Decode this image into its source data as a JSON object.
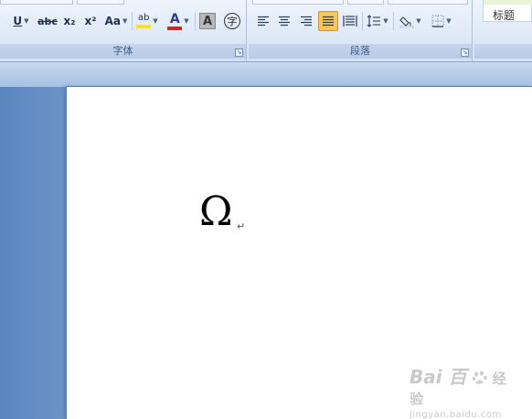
{
  "ribbon": {
    "font_group": {
      "label": "字体",
      "underline": "U",
      "strikethrough": "abc",
      "subscript": "x₂",
      "superscript": "x²",
      "change_case": "Aa",
      "highlight": "ab",
      "font_color": "A",
      "char_shading": "A",
      "enclose_char": "字"
    },
    "paragraph_group": {
      "label": "段落"
    },
    "styles_group": {
      "style_name": "标题"
    }
  },
  "document": {
    "content": "Ω",
    "paragraph_mark": "↵"
  },
  "watermark": {
    "logo": "Bai  百",
    "brand_cn": "经验",
    "url": "jingyan.baidu.com"
  },
  "colors": {
    "highlight_yellow": "#ffe600",
    "font_red": "#e0201a",
    "justify_active": "#f7c75a"
  }
}
